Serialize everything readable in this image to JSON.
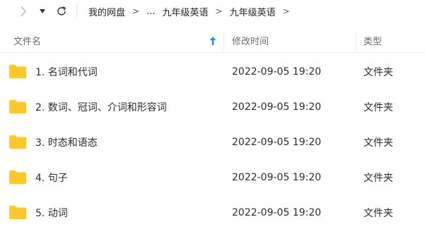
{
  "nav": {
    "forward_icon": "chevron-right-icon",
    "dropdown_icon": "caret-down-icon",
    "refresh_icon": "refresh-icon",
    "breadcrumbs": [
      "我的网盘",
      "...",
      "九年级英语",
      "九年级英语"
    ],
    "separator": ">"
  },
  "header": {
    "name_label": "文件名",
    "date_label": "修改时间",
    "type_label": "类型",
    "sort_icon": "sort-ascending-icon",
    "sort_color": "#2e8bf0"
  },
  "rows": [
    {
      "name": "1. 名词和代词",
      "date": "2022-09-05 19:20",
      "type": "文件夹"
    },
    {
      "name": "2. 数词、冠词、介词和形容词",
      "date": "2022-09-05 19:20",
      "type": "文件夹"
    },
    {
      "name": "3. 时态和语态",
      "date": "2022-09-05 19:20",
      "type": "文件夹"
    },
    {
      "name": "4. 句子",
      "date": "2022-09-05 19:20",
      "type": "文件夹"
    },
    {
      "name": "5. 动词",
      "date": "2022-09-05 19:20",
      "type": "文件夹"
    }
  ],
  "folder_color": "#ffc72b"
}
